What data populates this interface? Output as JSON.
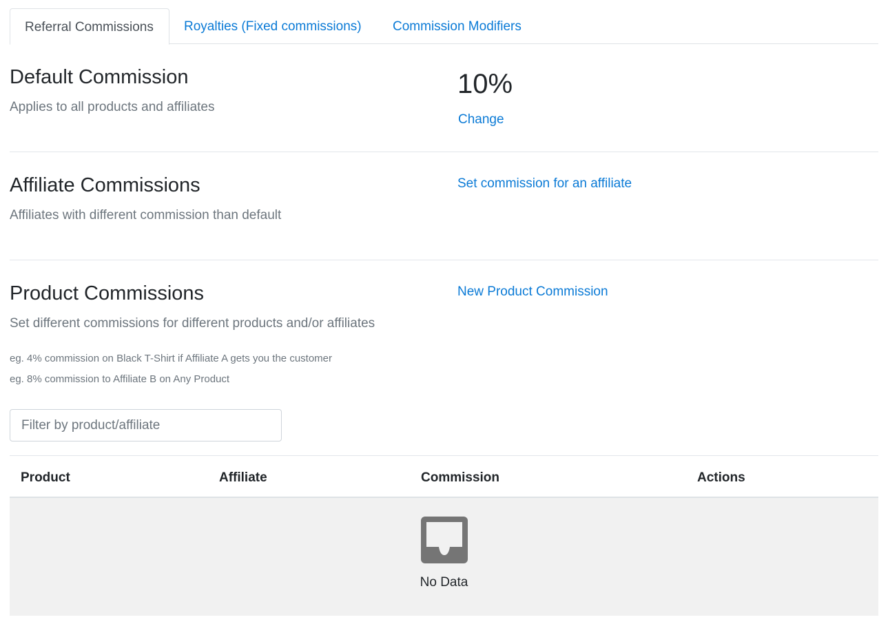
{
  "tabs": [
    {
      "label": "Referral Commissions",
      "active": true
    },
    {
      "label": "Royalties (Fixed commissions)",
      "active": false
    },
    {
      "label": "Commission Modifiers",
      "active": false
    }
  ],
  "default_commission": {
    "title": "Default Commission",
    "subtitle": "Applies to all products and affiliates",
    "value": "10%",
    "change_label": "Change"
  },
  "affiliate_commissions": {
    "title": "Affiliate Commissions",
    "subtitle": "Affiliates with different commission than default",
    "action_label": "Set commission for an affiliate"
  },
  "product_commissions": {
    "title": "Product Commissions",
    "subtitle": "Set different commissions for different products and/or affiliates",
    "action_label": "New Product Commission",
    "examples": [
      "eg. 4% commission on Black T-Shirt if Affiliate A gets you the customer",
      "eg. 8% commission to Affiliate B on Any Product"
    ],
    "filter_placeholder": "Filter by product/affiliate",
    "filter_value": ""
  },
  "table": {
    "columns": [
      "Product",
      "Affiliate",
      "Commission",
      "Actions"
    ],
    "rows": [],
    "empty_text": "No Data",
    "empty_icon": "inbox-icon"
  },
  "colors": {
    "link": "#0a7ad6",
    "muted": "#6c757d",
    "empty_bg": "#f1f1f1",
    "empty_icon": "#757575"
  }
}
